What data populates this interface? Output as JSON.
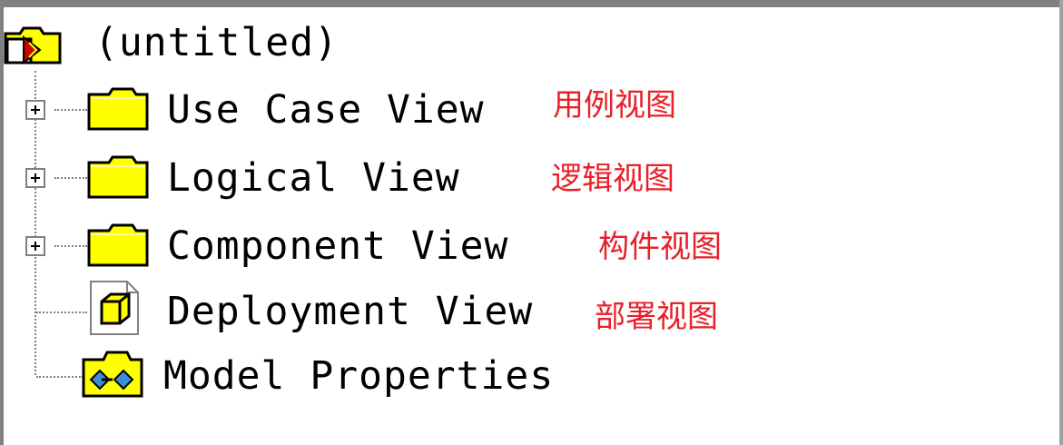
{
  "tree": {
    "root": {
      "label": "(untitled)",
      "icon": "model-root-icon"
    },
    "items": [
      {
        "label": "Use Case View",
        "icon": "folder-icon",
        "expandable": true,
        "annotation": "用例视图"
      },
      {
        "label": "Logical View",
        "icon": "folder-icon",
        "expandable": true,
        "annotation": "逻辑视图"
      },
      {
        "label": "Component View",
        "icon": "folder-icon",
        "expandable": true,
        "annotation": "构件视图"
      },
      {
        "label": "Deployment View",
        "icon": "deployment-node-icon",
        "expandable": false,
        "annotation": "部署视图"
      },
      {
        "label": "Model Properties",
        "icon": "model-properties-icon",
        "expandable": false
      }
    ]
  },
  "colors": {
    "folder_fill": "#ffff00",
    "annotation": "#e8202a",
    "tree_line": "#808080"
  }
}
